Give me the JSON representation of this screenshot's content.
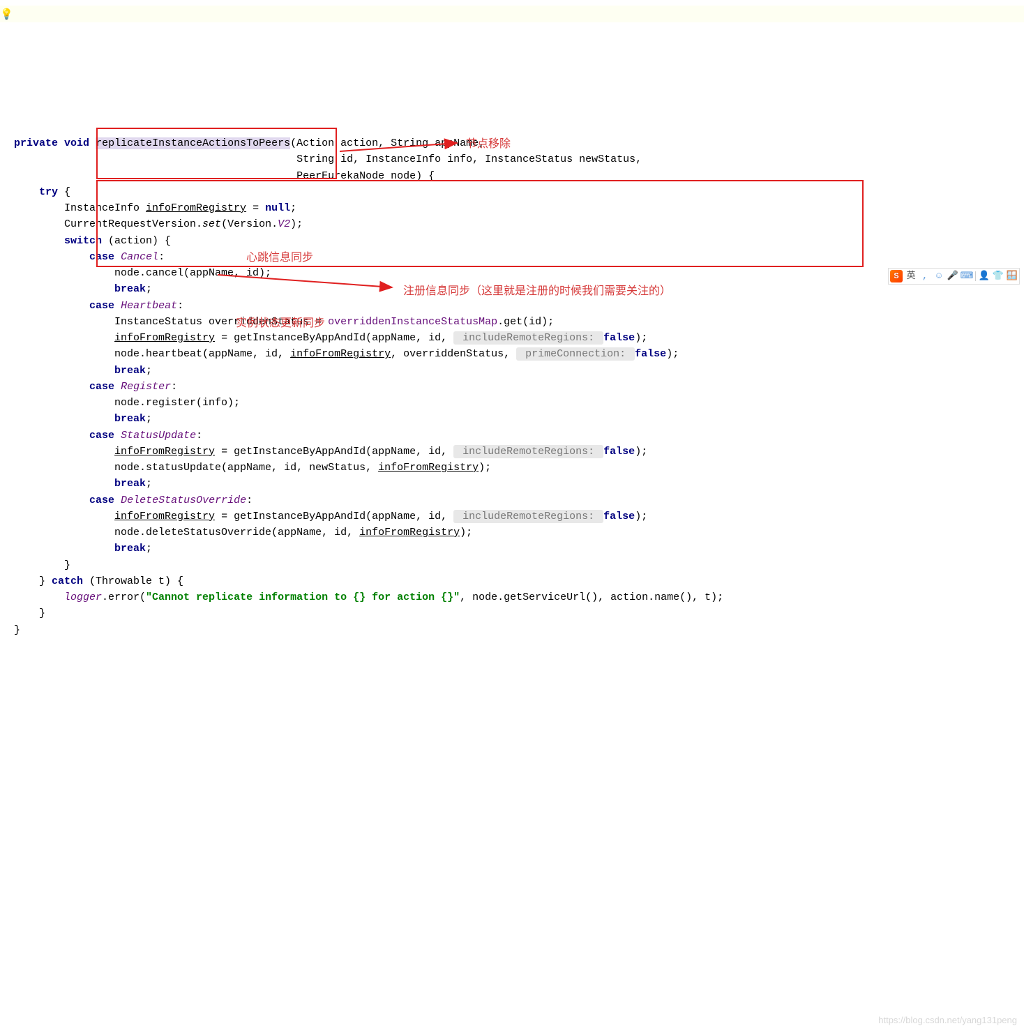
{
  "gutter": {
    "icon": "💡"
  },
  "code": {
    "kw_private": "private",
    "kw_void": "void",
    "method_name": "replicateInstanceActionsToPeers",
    "param1": "(Action action, String appName,",
    "param2_indent": "                                             String id, InstanceInfo info, InstanceStatus newStatus,",
    "param3_indent": "                                             PeerEurekaNode node) {",
    "kw_try": "try",
    "try_open": " {",
    "line_info_null_a": "        InstanceInfo ",
    "line_info_null_b": "infoFromRegistry",
    "line_info_null_c": " = ",
    "kw_null": "null",
    "line_info_null_d": ";",
    "crv_a": "        CurrentRequestVersion.",
    "crv_set": "set",
    "crv_b": "(Version.",
    "crv_v2": "V2",
    "crv_c": ");",
    "switch_kw": "switch",
    "switch_txt": " (action) {",
    "case_kw": "case",
    "case_cancel": "Cancel",
    "colon": ":",
    "cancel_body": "                node.cancel(appName, id);",
    "kw_break": "break",
    "semi": ";",
    "case_heartbeat": "Heartbeat",
    "hb_l1_a": "                InstanceStatus overriddenStatus = ",
    "hb_l1_b": "overriddenInstanceStatusMap",
    "hb_l1_c": ".get(id);",
    "hb_l2_a": "                ",
    "hb_l2_b": "infoFromRegistry",
    "hb_l2_c": " = getInstanceByAppAndId(appName, id, ",
    "hint_irr": " includeRemoteRegions: ",
    "kw_false": "false",
    "paren_close": ");",
    "hb_l3_a": "                node.heartbeat(appName, id, ",
    "hb_l3_b": "infoFromRegistry",
    "hb_l3_c": ", overriddenStatus, ",
    "hint_prime": " primeConnection: ",
    "case_register": "Register",
    "reg_body": "                node.register(info);",
    "case_status": "StatusUpdate",
    "su_l2": "                node.statusUpdate(appName, id, newStatus, ",
    "su_l2b": "infoFromRegistry",
    "case_delete": "DeleteStatusOverride",
    "del_l2": "                node.deleteStatusOverride(appName, id, ",
    "switch_close": "        }",
    "try_close": "    } ",
    "kw_catch": "catch",
    "catch_txt": " (Throwable t) {",
    "logger": "logger",
    "logger_b": ".error(",
    "logger_str": "\"Cannot replicate information to {} for action {}\"",
    "logger_c": ", node.getServiceUrl(), action.name(), t);",
    "catch_close": "    }",
    "method_close": "}"
  },
  "annotations": {
    "a1": "节点移除",
    "a2": "心跳信息同步",
    "a3": "注册信息同步（这里就是注册的时候我们需要关注的）",
    "a4": "实例状态更新同步"
  },
  "ime": {
    "logo": "S",
    "lang": "英",
    "i1": ",",
    "i2": "☺",
    "i3": "🎤",
    "i4": "⌨",
    "i5": "👤",
    "i6": "👕",
    "i7": "🪟"
  },
  "watermark": "https://blog.csdn.net/yang131peng"
}
